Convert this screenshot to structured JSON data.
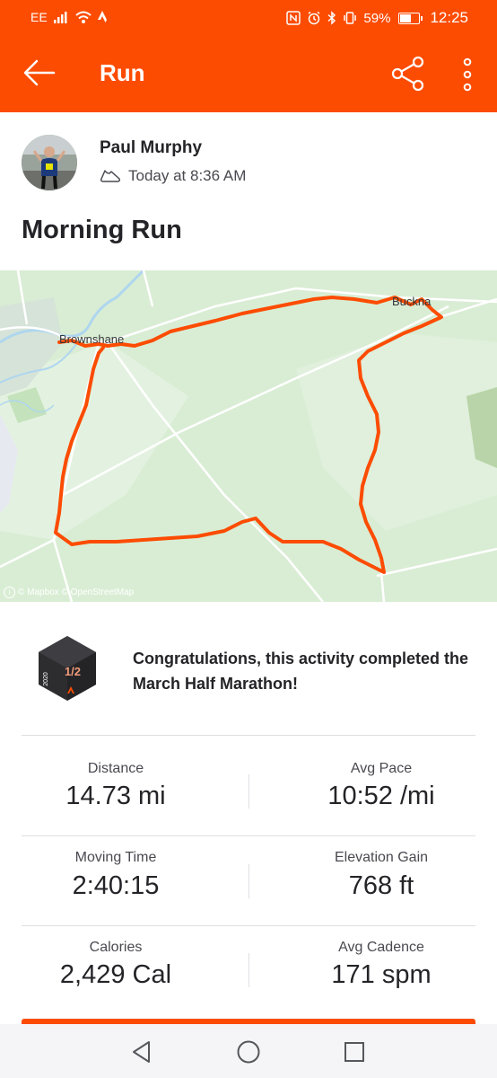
{
  "status_bar": {
    "carrier": "EE",
    "battery": "59%",
    "time": "12:25"
  },
  "app_bar": {
    "title": "Run"
  },
  "activity": {
    "athlete_name": "Paul Murphy",
    "timestamp": "Today at 8:36 AM",
    "title": "Morning Run"
  },
  "map": {
    "town_label_1": "Brownshane",
    "town_label_2": "Buckna",
    "attribution": "© Mapbox © OpenStreetMap",
    "route_color": "#fc4c02"
  },
  "achievement": {
    "badge_year": "2020",
    "badge_fraction": "1/2",
    "message": "Congratulations, this activity completed the March Half Marathon!"
  },
  "stats": [
    {
      "label": "Distance",
      "value": "14.73 mi"
    },
    {
      "label": "Avg Pace",
      "value": "10:52 /mi"
    },
    {
      "label": "Moving Time",
      "value": "2:40:15"
    },
    {
      "label": "Elevation Gain",
      "value": "768 ft"
    },
    {
      "label": "Calories",
      "value": "2,429 Cal"
    },
    {
      "label": "Avg Cadence",
      "value": "171 spm"
    }
  ],
  "colors": {
    "brand": "#fc4c02",
    "text_primary": "#242428",
    "text_secondary": "#494950"
  },
  "icons": {
    "back": "arrow-left-icon",
    "share": "share-icon",
    "more": "more-vertical-icon",
    "activity_type": "shoe-icon",
    "nav_back": "triangle-back-icon",
    "nav_home": "circle-home-icon",
    "nav_recents": "square-recents-icon"
  }
}
